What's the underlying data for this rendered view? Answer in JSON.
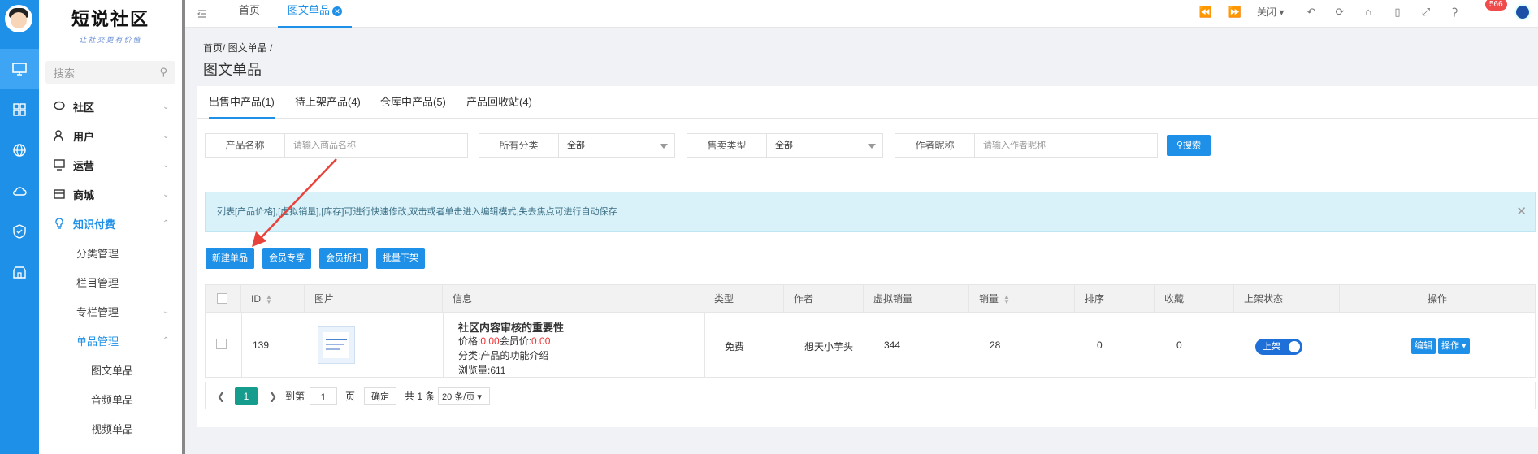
{
  "sidebar": {
    "logo_title": "短说社区",
    "logo_subtitle": "让社交更有价值",
    "search_placeholder": "搜索",
    "menu": [
      {
        "label": "社区"
      },
      {
        "label": "用户"
      },
      {
        "label": "运营"
      },
      {
        "label": "商城"
      },
      {
        "label": "知识付费"
      }
    ],
    "sub": [
      "分类管理",
      "栏目管理",
      "专栏管理",
      "单品管理"
    ],
    "sub3": [
      "图文单品",
      "音频单品",
      "视频单品"
    ]
  },
  "topbar": {
    "tabs": [
      "首页",
      "图文单品"
    ],
    "close_label": "关闭",
    "badge": "566"
  },
  "page": {
    "breadcrumb": "首页/ 图文单品 /",
    "title": "图文单品"
  },
  "tabs": [
    "出售中产品(1)",
    "待上架产品(4)",
    "仓库中产品(5)",
    "产品回收站(4)"
  ],
  "filters": {
    "name_label": "产品名称",
    "name_placeholder": "请输入商品名称",
    "category_label": "所有分类",
    "category_value": "全部",
    "saletype_label": "售卖类型",
    "saletype_value": "全部",
    "author_label": "作者昵称",
    "author_placeholder": "请输入作者昵称",
    "search_button": "搜索"
  },
  "alert": "列表[产品价格],[虚拟销量],[库存]可进行快速修改,双击或者单击进入编辑模式,失去焦点可进行自动保存",
  "actions": [
    "新建单品",
    "会员专享",
    "会员折扣",
    "批量下架"
  ],
  "table": {
    "columns": [
      "ID",
      "图片",
      "信息",
      "类型",
      "作者",
      "虚拟销量",
      "销量",
      "排序",
      "收藏",
      "上架状态",
      "操作"
    ],
    "row": {
      "id": "139",
      "title": "社区内容审核的重要性",
      "price_label": "价格:",
      "price": "0.00",
      "member_label": "会员价:",
      "member_price": "0.00",
      "category": "分类:产品的功能介绍",
      "views": "浏览量:611",
      "type": "免费",
      "author": "想天小芋头",
      "virtual_sales": "344",
      "sales": "28",
      "sort": "0",
      "favorites": "0",
      "status": "上架",
      "edit": "编辑",
      "ops": "操作"
    }
  },
  "pager": {
    "page": "1",
    "goto": "到第",
    "input": "1",
    "page_unit": "页",
    "confirm": "确定",
    "total": "共 1 条",
    "size": "20 条/页"
  }
}
